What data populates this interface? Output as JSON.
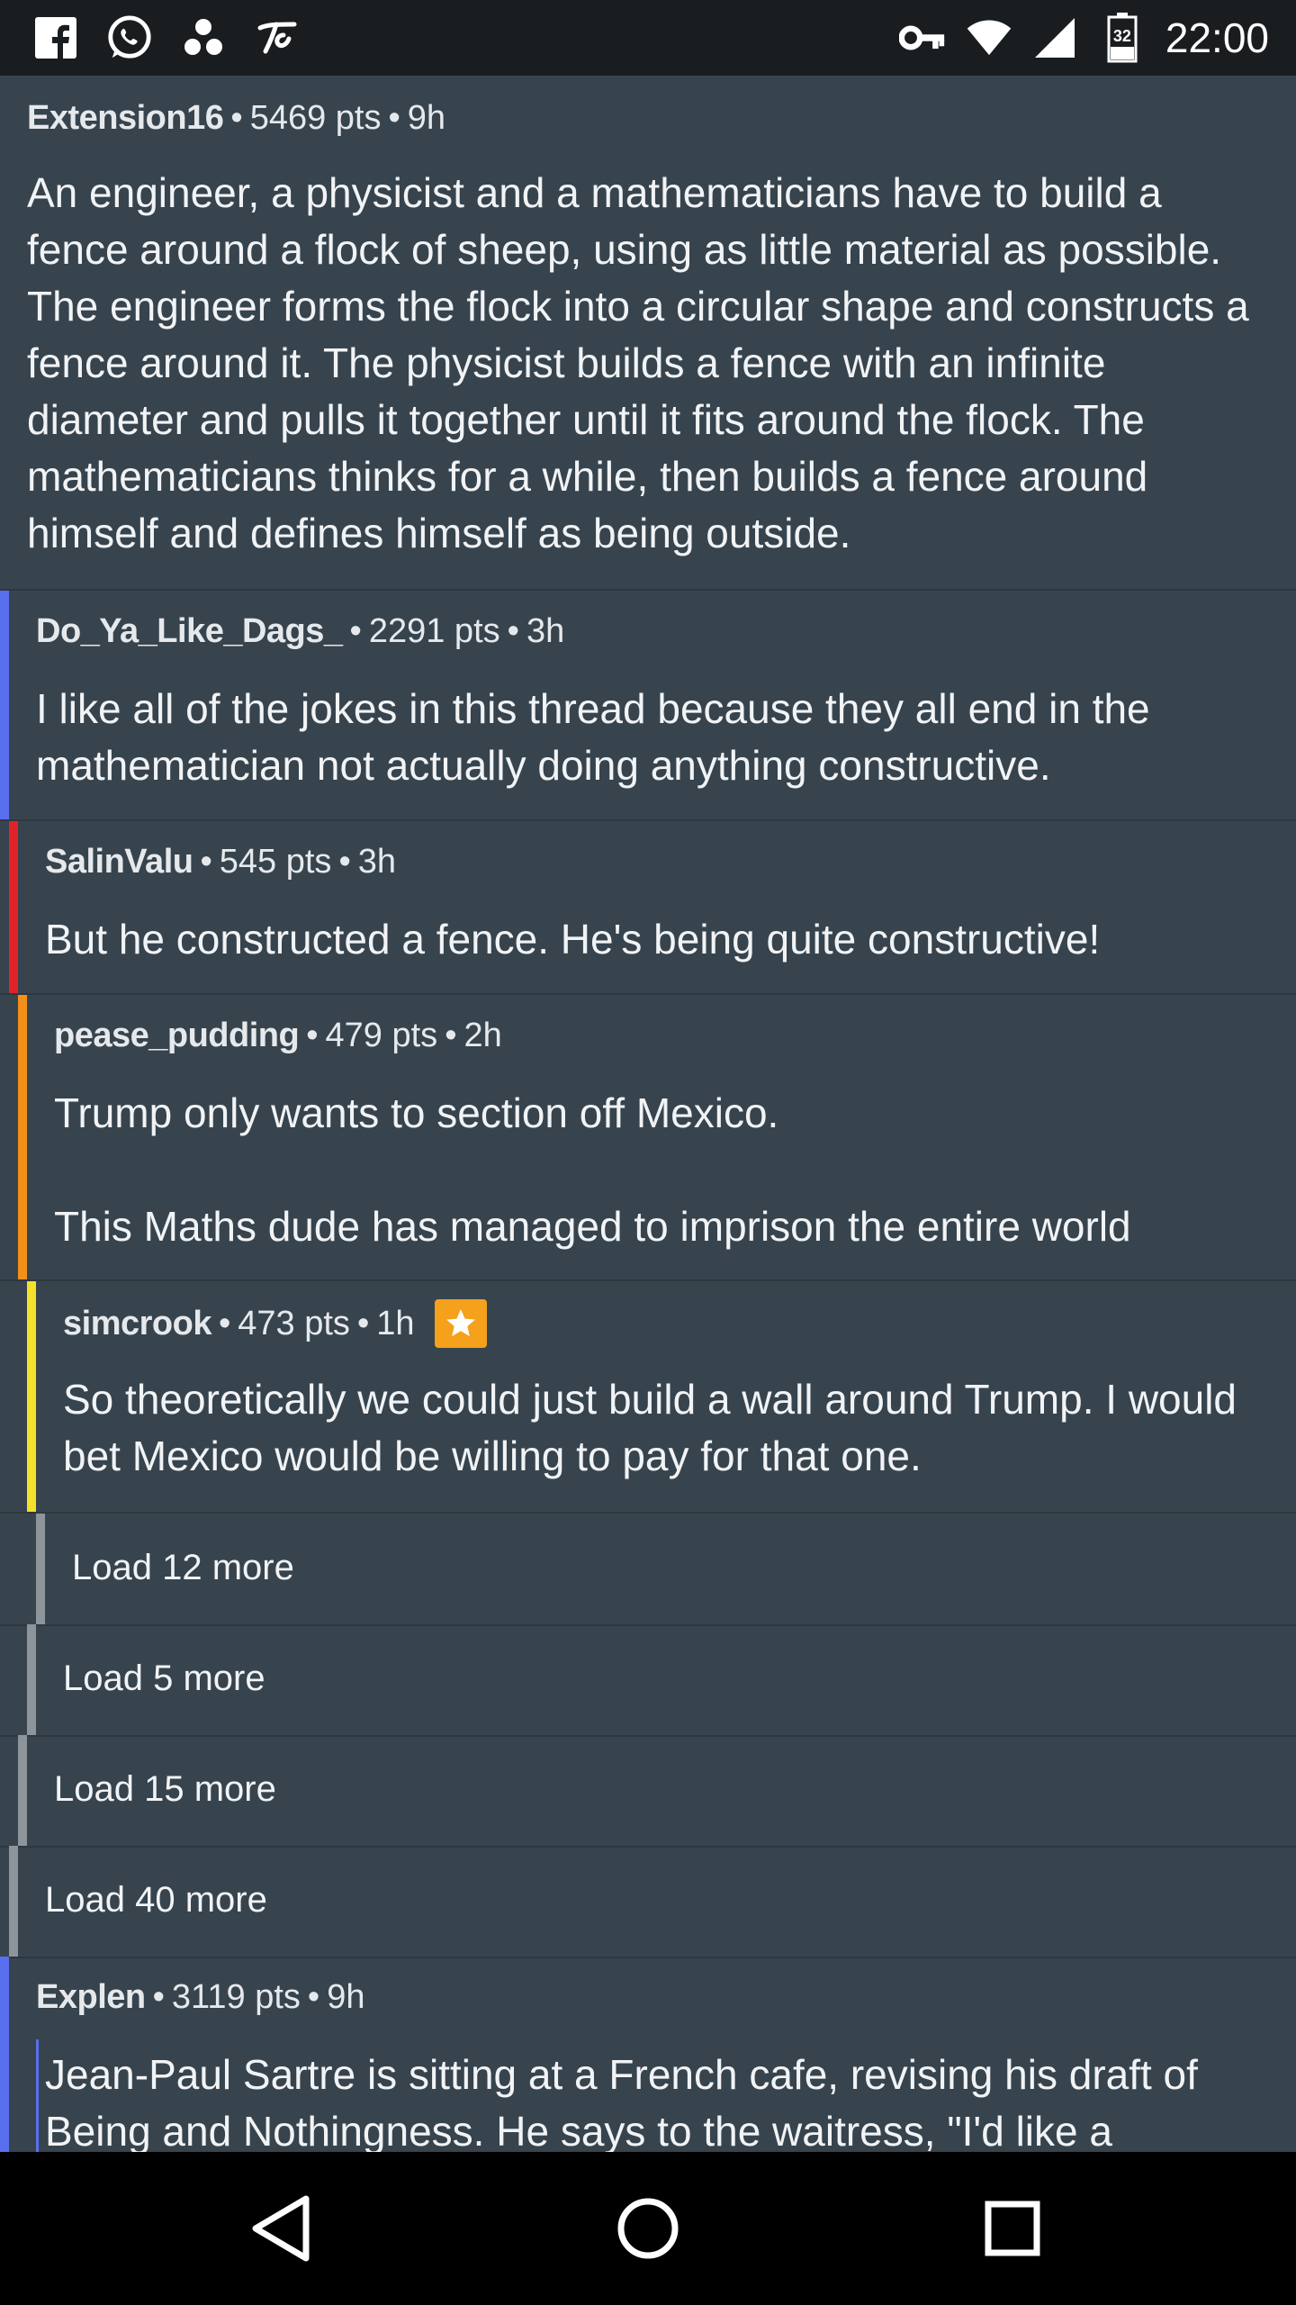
{
  "status_bar": {
    "time": "22:00",
    "battery_level": "32",
    "left_icons": [
      "facebook-icon",
      "whatsapp-icon",
      "three-dots-app-icon",
      "tinder-like-app-icon"
    ],
    "right_icons": [
      "vpn-key-icon",
      "wifi-icon",
      "cell-signal-icon",
      "battery-icon"
    ]
  },
  "comments": [
    {
      "author": "Extension16",
      "points": "5469 pts",
      "age": "9h",
      "bar_color": "",
      "text": "An engineer, a physicist and a mathematicians have to build a fence around a flock of sheep, using as little material as possible. The engineer forms the flock into a circular shape and constructs a fence around it. The physicist builds a fence with an infinite diameter and pulls it together until it fits around the flock. The mathematicians thinks for a while, then builds a fence around himself and defines himself as being outside."
    },
    {
      "author": "Do_Ya_Like_Dags_",
      "points": "2291 pts",
      "age": "3h",
      "bar_color": "#5a6ef0",
      "text": "I like all of the jokes in this thread because they all end in the mathematician not actually doing anything constructive."
    },
    {
      "author": "SalinValu",
      "points": "545 pts",
      "age": "3h",
      "bar_color": "#e0222a",
      "text": "But he constructed a fence. He's being quite constructive!"
    },
    {
      "author": "pease_pudding",
      "points": "479 pts",
      "age": "2h",
      "bar_color": "#f39019",
      "text_line1": "Trump only wants to section off Mexico.",
      "text_line2": "This Maths dude has managed to imprison the entire world"
    },
    {
      "author": "simcrook",
      "points": "473 pts",
      "age": "1h",
      "bar_color": "#f4e12a",
      "badge": "gold-star-icon",
      "text": "So theoretically we could just build a wall around Trump. I would bet Mexico would be willing to pay for that one."
    },
    {
      "author": "Explen",
      "points": "3119 pts",
      "age": "9h",
      "bar_color": "#5a6ef0",
      "text": "Jean-Paul Sartre is sitting at a French cafe, revising his draft of Being and Nothingness. He says to the waitress, \"I'd like a"
    }
  ],
  "load_more": [
    "Load 12 more",
    "Load 5 more",
    "Load 15 more",
    "Load 40 more"
  ],
  "separator": "•",
  "navbar": [
    "back-icon",
    "home-icon",
    "recents-icon"
  ]
}
